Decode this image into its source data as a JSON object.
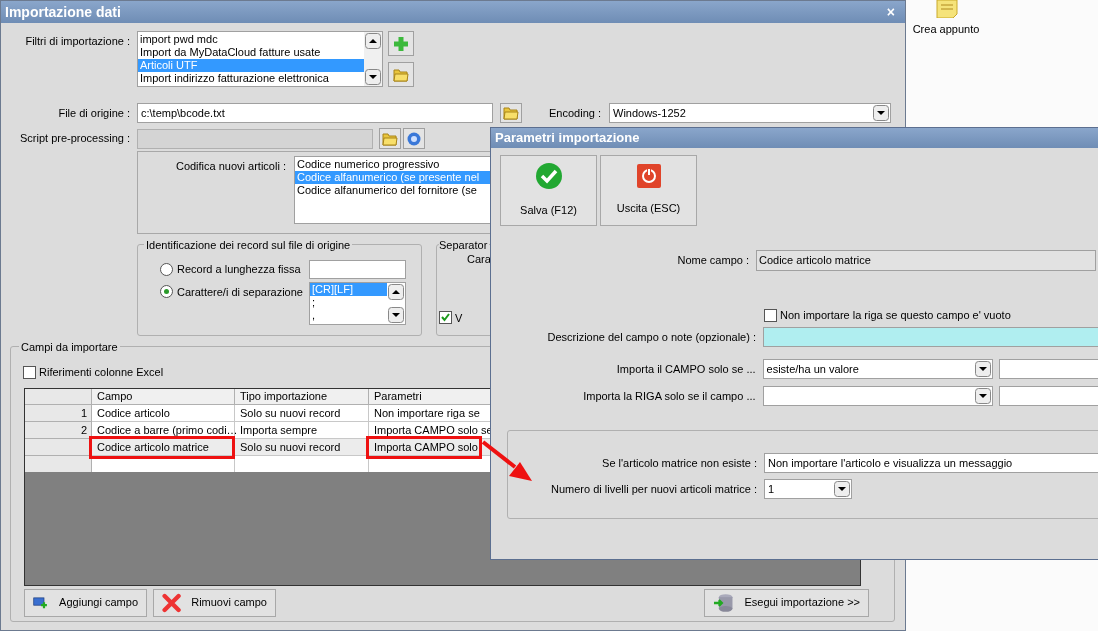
{
  "desktop": {
    "icons": [
      {
        "label": "Crea appunto"
      }
    ]
  },
  "main_window": {
    "title": "Importazione dati",
    "close": "×",
    "filters": {
      "label": "Filtri di importazione :",
      "items": [
        {
          "label": "import pwd mdc",
          "selected": false
        },
        {
          "label": "Import da MyDataCloud fatture usate",
          "selected": false
        },
        {
          "label": "Articoli UTF",
          "selected": true
        },
        {
          "label": "Import indirizzo fatturazione elettronica",
          "selected": false
        }
      ]
    },
    "source_file": {
      "label": "File di origine :",
      "value": "c:\\temp\\bcode.txt"
    },
    "encoding": {
      "label": "Encoding :",
      "value": "Windows-1252"
    },
    "script": {
      "label": "Script pre-processing :",
      "disabled": true
    },
    "new_article_coding": {
      "label": "Codifica nuovi articoli :",
      "items": [
        {
          "label": "Codice numerico progressivo",
          "selected": false
        },
        {
          "label": "Codice alfanumerico (se presente nel",
          "selected": true
        },
        {
          "label": "Codice alfanumerico del fornitore (se",
          "selected": false
        }
      ]
    },
    "record_identification": {
      "title": "Identificazione dei record sul file di origine",
      "options": [
        {
          "label": "Record a lunghezza fissa",
          "selected": false
        },
        {
          "label": "Carattere/i di separazione",
          "selected": true
        }
      ],
      "separators": [
        {
          "label": "[CR][LF]",
          "selected": true
        },
        {
          "label": ";",
          "selected": false
        },
        {
          "label": ",",
          "selected": false
        }
      ]
    },
    "separator_group": {
      "title": "Separator",
      "label": "Cara",
      "checkbox": {
        "label": "V",
        "checked": true
      }
    },
    "fields_group": {
      "title": "Campi da importare",
      "excel_refs": {
        "label": "Riferimenti colonne Excel",
        "checked": false
      },
      "table": {
        "columns": [
          "Campo",
          "Tipo importazione",
          "Parametri"
        ],
        "rows": [
          {
            "index": "1",
            "cells": [
              "Codice articolo",
              "Solo su nuovi record",
              "Non importare riga se"
            ],
            "highlighted": false
          },
          {
            "index": "2",
            "cells": [
              "Codice a barre (primo codi…",
              "Importa sempre",
              "Importa CAMPO solo se"
            ],
            "highlighted": false
          },
          {
            "cells": [
              "Codice articolo matrice",
              "Solo su nuovi record",
              "Importa CAMPO solo"
            ],
            "highlighted": true
          }
        ]
      }
    },
    "buttons": [
      {
        "label": "Aggiungi campo",
        "kind": "add"
      },
      {
        "label": "Rimuovi campo",
        "kind": "remove"
      },
      {
        "label": "Esegui importazione >>",
        "kind": "run"
      }
    ]
  },
  "dialog": {
    "title": "Parametri importazione",
    "buttons": [
      {
        "label": "Salva (F12)",
        "kind": "save"
      },
      {
        "label": "Uscita (ESC)",
        "kind": "exit"
      }
    ],
    "field_name": {
      "label": "Nome campo :",
      "value": "Codice articolo matrice"
    },
    "skip_empty": {
      "label": "Non importare la riga se questo campo e' vuoto",
      "checked": false
    },
    "description": {
      "label": "Descrizione del campo o note (opzionale) :"
    },
    "campo_condition": {
      "label": "Importa il CAMPO solo se ...",
      "value": "esiste/ha un valore"
    },
    "riga_condition": {
      "label": "Importa la RIGA solo se il campo ..."
    },
    "matrix_missing": {
      "label": "Se l'articolo matrice non esiste :",
      "value": "Non importare l'articolo e visualizza un messaggio"
    },
    "levels": {
      "label": "Numero di livelli per nuovi articoli matrice :",
      "value": "1"
    }
  }
}
